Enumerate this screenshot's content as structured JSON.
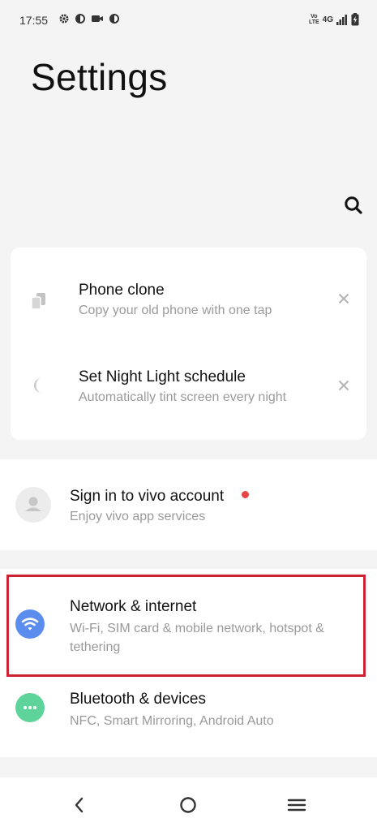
{
  "status_bar": {
    "time": "17:55",
    "network_type": "4G",
    "volte_top": "Vo",
    "volte_bottom": "LTE"
  },
  "header": {
    "title": "Settings"
  },
  "suggestions": [
    {
      "title": "Phone clone",
      "subtitle": "Copy your old phone with one tap",
      "icon": "phone-clone-icon"
    },
    {
      "title": "Set Night Light schedule",
      "subtitle": "Automatically tint screen every night",
      "icon": "moon-icon"
    }
  ],
  "account": {
    "title": "Sign in to vivo account",
    "subtitle": "Enjoy vivo app services",
    "badge_color": "#e84545"
  },
  "settings": [
    {
      "title": "Network & internet",
      "subtitle": "Wi-Fi, SIM card & mobile network, hotspot & tethering",
      "icon": "wifi-icon",
      "color": "#5b8def"
    },
    {
      "title": "Bluetooth & devices",
      "subtitle": "NFC, Smart Mirroring, Android Auto",
      "icon": "more-dots-icon",
      "color": "#5ed39a"
    }
  ],
  "highlight_color": "#cc2233"
}
